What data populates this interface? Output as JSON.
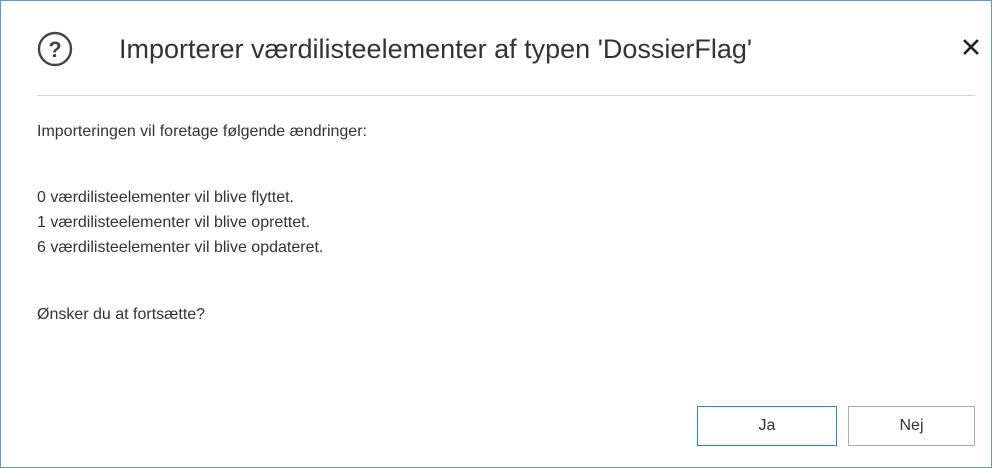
{
  "dialog": {
    "title": "Importerer værdilisteelementer af typen 'DossierFlag'",
    "intro": "Importeringen vil foretage følgende ændringer:",
    "changes": [
      "0 værdilisteelementer vil blive flyttet.",
      "1 værdilisteelementer vil blive oprettet.",
      "6 værdilisteelementer vil blive opdateret."
    ],
    "question": "Ønsker du at fortsætte?",
    "yes_label": "Ja",
    "no_label": "Nej",
    "icons": {
      "help": "question-circle-icon",
      "close": "close-icon"
    },
    "colors": {
      "border": "#5b9bd5",
      "primary_button_border": "#2b88d8",
      "button_border": "#ababab",
      "text": "#333333"
    }
  }
}
